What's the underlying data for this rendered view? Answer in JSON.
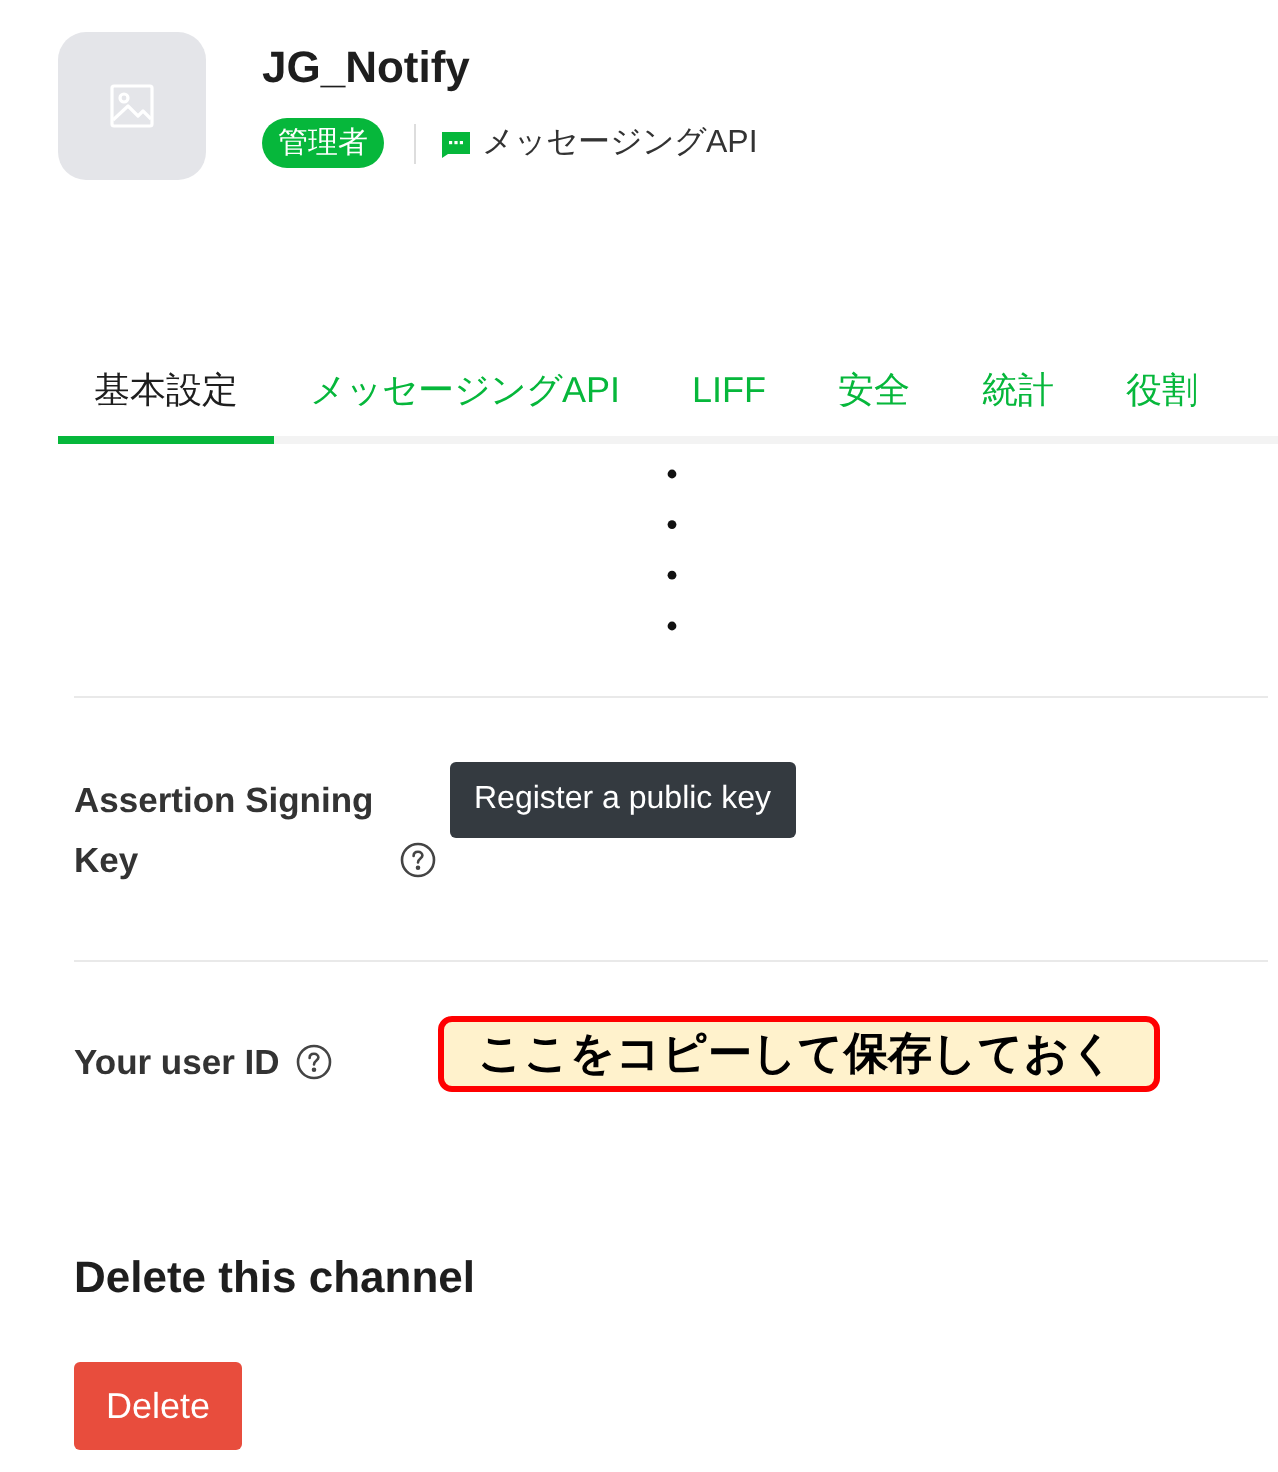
{
  "channel": {
    "name": "JG_Notify",
    "role": "管理者",
    "product": "メッセージングAPI"
  },
  "tabs": [
    {
      "label": "基本設定",
      "selected": true
    },
    {
      "label": "メッセージングAPI",
      "selected": false
    },
    {
      "label": "LIFF",
      "selected": false
    },
    {
      "label": "安全",
      "selected": false
    },
    {
      "label": "統計",
      "selected": false
    },
    {
      "label": "役割",
      "selected": false
    }
  ],
  "settings": [
    {
      "kind": "button",
      "label": "Assertion Signing Key",
      "help": true,
      "button": "Register a public key"
    },
    {
      "kind": "annotation",
      "label": "Your user ID",
      "help": true,
      "annotation": "ここをコピーして保存しておく"
    }
  ],
  "danger_zone": {
    "heading": "Delete this channel",
    "button": "Delete"
  }
}
